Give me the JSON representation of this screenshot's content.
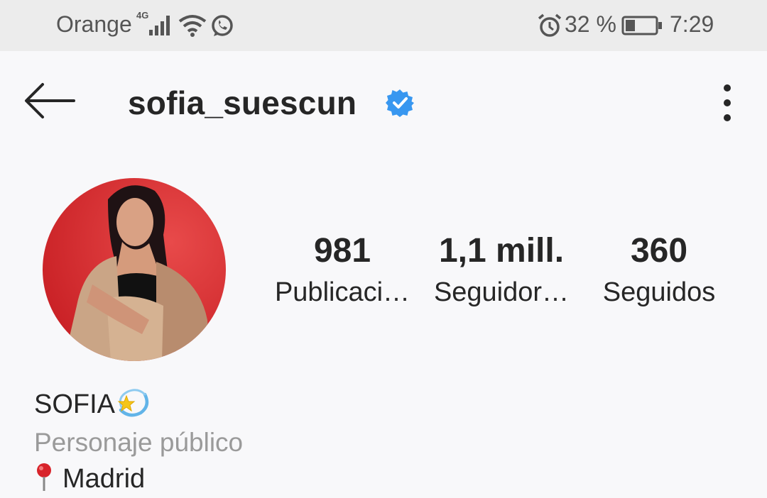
{
  "status_bar": {
    "carrier": "Orange",
    "network": "4G",
    "battery_percent": "32 %",
    "battery_level": 0.32,
    "time": "7:29",
    "icons": [
      "signal-icon",
      "wifi-icon",
      "whatsapp-icon",
      "alarm-icon",
      "battery-icon"
    ]
  },
  "header": {
    "username": "sofia_suescun",
    "verified": true,
    "verified_color": "#3897f0"
  },
  "stats": [
    {
      "value": "981",
      "label": "Publicaci…"
    },
    {
      "value": "1,1 mill.",
      "label": "Seguidor…"
    },
    {
      "value": "360",
      "label": "Seguidos"
    }
  ],
  "bio": {
    "name": "SOFIA",
    "category": "Personaje público",
    "location": "Madrid"
  }
}
